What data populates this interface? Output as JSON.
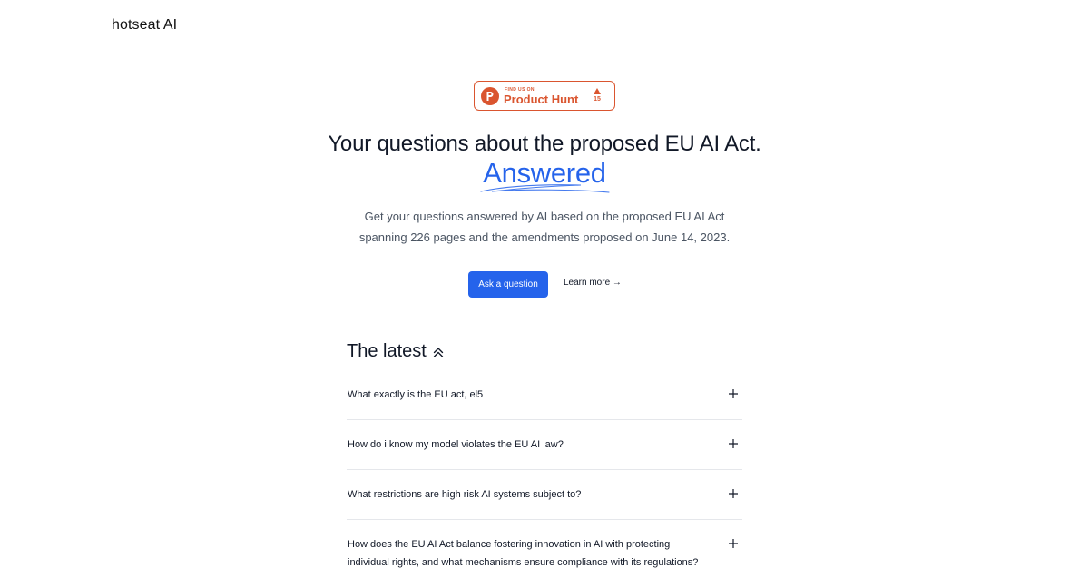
{
  "nav": {
    "brand": "hotseat AI"
  },
  "product_hunt": {
    "small_text": "FIND US ON",
    "name": "Product Hunt",
    "votes": "15",
    "brand_color": "#da552f"
  },
  "hero": {
    "title": "Your questions about the proposed EU AI Act.",
    "accent": "Answered",
    "accent_color": "#2563eb",
    "description_line1": "Get your questions answered by AI based on the proposed EU AI Act",
    "description_line2": "spanning 226 pages and the amendments proposed on June 14, 2023.",
    "primary_button": "Ask a question",
    "secondary_link": "Learn more →"
  },
  "latest": {
    "title": "The latest",
    "icon": "chevrons-up-icon",
    "items": [
      {
        "question": "What exactly is the EU act, el5"
      },
      {
        "question": "How do i know my model violates the EU AI law?"
      },
      {
        "question": "What restrictions are high risk AI systems subject to?"
      },
      {
        "question": "How does the EU AI Act balance fostering innovation in AI with protecting individual rights, and what mechanisms ensure compliance with its regulations?"
      }
    ]
  }
}
